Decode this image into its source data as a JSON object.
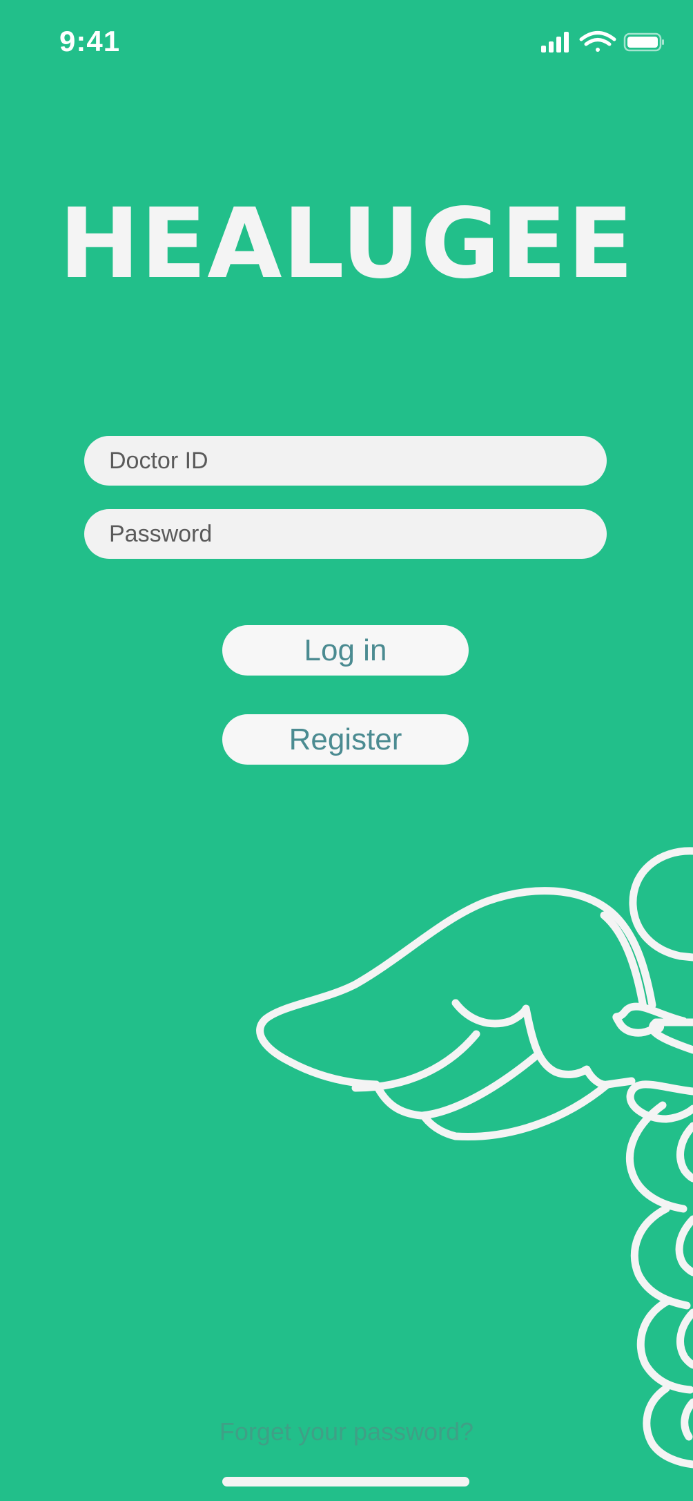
{
  "status_bar": {
    "time": "9:41",
    "icons": [
      "signal-icon",
      "wifi-icon",
      "battery-icon"
    ]
  },
  "app": {
    "title": "HEALUGEE"
  },
  "form": {
    "doctor_id_placeholder": "Doctor ID",
    "password_placeholder": "Password",
    "login_label": "Log in",
    "register_label": "Register",
    "forgot_label": "Forget your password?"
  },
  "decoration": {
    "icon": "caduceus-icon"
  },
  "colors": {
    "background": "#22bf8a",
    "field": "#f2f2f2",
    "button_text": "#4b8b91",
    "link": "#3fa086",
    "white": "#f4f4f4"
  }
}
